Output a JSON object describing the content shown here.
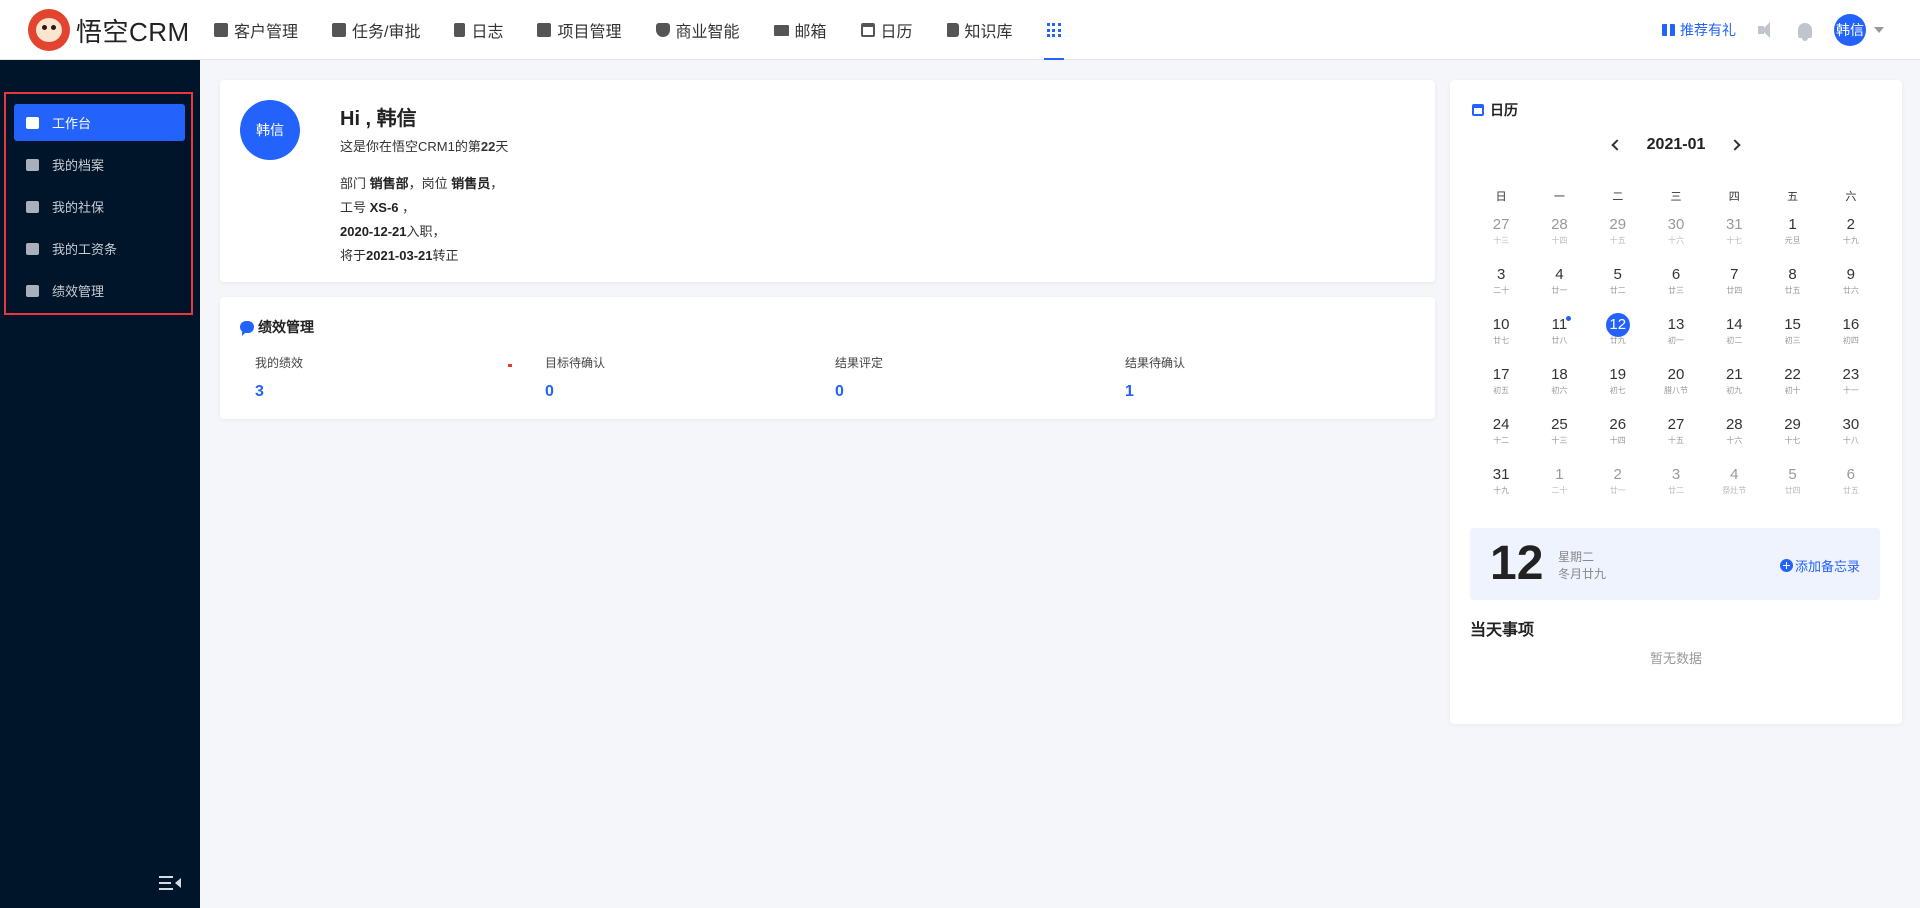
{
  "app": {
    "name": "悟空CRM"
  },
  "nav": [
    {
      "label": "客户管理",
      "icon": "building-icon"
    },
    {
      "label": "任务/审批",
      "icon": "briefcase-icon"
    },
    {
      "label": "日志",
      "icon": "document-icon"
    },
    {
      "label": "项目管理",
      "icon": "board-icon"
    },
    {
      "label": "商业智能",
      "icon": "shield-icon"
    },
    {
      "label": "邮箱",
      "icon": "envelope-icon"
    },
    {
      "label": "日历",
      "icon": "calendar-icon"
    },
    {
      "label": "知识库",
      "icon": "book-icon"
    }
  ],
  "topright": {
    "recommend": "推荐有礼",
    "user": "韩信"
  },
  "sidebar": {
    "items": [
      {
        "label": "工作台",
        "icon": "monitor-icon",
        "active": true
      },
      {
        "label": "我的档案",
        "icon": "archive-icon"
      },
      {
        "label": "我的社保",
        "icon": "insurance-icon"
      },
      {
        "label": "我的工资条",
        "icon": "payslip-icon"
      },
      {
        "label": "绩效管理",
        "icon": "bar-chart-icon"
      }
    ]
  },
  "profile": {
    "avatar": "韩信",
    "greeting": "Hi , 韩信",
    "days_pre": "这是你在悟空CRM1的第",
    "days": "22",
    "days_post": "天",
    "dept_label": "部门 ",
    "dept": "销售部",
    "post_label": "，岗位 ",
    "post": "销售员",
    "line_end": "，",
    "emp_label": "工号 ",
    "emp_no": "XS-6",
    "emp_end": " ，",
    "join_date": "2020-12-21",
    "join_label": "入职，",
    "reg_pre": "将于",
    "reg_date": "2021-03-21",
    "reg_post": "转正"
  },
  "performance": {
    "title": "绩效管理",
    "stats": [
      {
        "label": "我的绩效",
        "value": "3"
      },
      {
        "label": "目标待确认",
        "value": "0"
      },
      {
        "label": "结果评定",
        "value": "0"
      },
      {
        "label": "结果待确认",
        "value": "1"
      }
    ]
  },
  "calendar": {
    "title": "日历",
    "month": "2021-01",
    "weekdays": [
      "日",
      "一",
      "二",
      "三",
      "四",
      "五",
      "六"
    ],
    "days": [
      {
        "d": "27",
        "l": "十三",
        "other": true
      },
      {
        "d": "28",
        "l": "十四",
        "other": true
      },
      {
        "d": "29",
        "l": "十五",
        "other": true
      },
      {
        "d": "30",
        "l": "十六",
        "other": true
      },
      {
        "d": "31",
        "l": "十七",
        "other": true
      },
      {
        "d": "1",
        "l": "元旦"
      },
      {
        "d": "2",
        "l": "十九"
      },
      {
        "d": "3",
        "l": "二十"
      },
      {
        "d": "4",
        "l": "廿一"
      },
      {
        "d": "5",
        "l": "廿二"
      },
      {
        "d": "6",
        "l": "廿三"
      },
      {
        "d": "7",
        "l": "廿四"
      },
      {
        "d": "8",
        "l": "廿五"
      },
      {
        "d": "9",
        "l": "廿六"
      },
      {
        "d": "10",
        "l": "廿七"
      },
      {
        "d": "11",
        "l": "廿八",
        "mark": true
      },
      {
        "d": "12",
        "l": "廿九",
        "today": true
      },
      {
        "d": "13",
        "l": "初一"
      },
      {
        "d": "14",
        "l": "初二"
      },
      {
        "d": "15",
        "l": "初三"
      },
      {
        "d": "16",
        "l": "初四"
      },
      {
        "d": "17",
        "l": "初五"
      },
      {
        "d": "18",
        "l": "初六"
      },
      {
        "d": "19",
        "l": "初七"
      },
      {
        "d": "20",
        "l": "腊八节"
      },
      {
        "d": "21",
        "l": "初九"
      },
      {
        "d": "22",
        "l": "初十"
      },
      {
        "d": "23",
        "l": "十一"
      },
      {
        "d": "24",
        "l": "十二"
      },
      {
        "d": "25",
        "l": "十三"
      },
      {
        "d": "26",
        "l": "十四"
      },
      {
        "d": "27",
        "l": "十五"
      },
      {
        "d": "28",
        "l": "十六"
      },
      {
        "d": "29",
        "l": "十七"
      },
      {
        "d": "30",
        "l": "十八"
      },
      {
        "d": "31",
        "l": "十九"
      },
      {
        "d": "1",
        "l": "二十",
        "other": true
      },
      {
        "d": "2",
        "l": "廿一",
        "other": true
      },
      {
        "d": "3",
        "l": "廿二",
        "other": true
      },
      {
        "d": "4",
        "l": "祭灶节",
        "other": true
      },
      {
        "d": "5",
        "l": "廿四",
        "other": true
      },
      {
        "d": "6",
        "l": "廿五",
        "other": true
      }
    ],
    "selected": {
      "day": "12",
      "weekday": "星期二",
      "lunar": "冬月廿九"
    },
    "add_memo": "添加备忘录",
    "events_title": "当天事项",
    "empty": "暂无数据"
  },
  "colors": {
    "accent": "#2362fb",
    "sidebar_bg": "#001529",
    "highlight_border": "#e8383d"
  }
}
